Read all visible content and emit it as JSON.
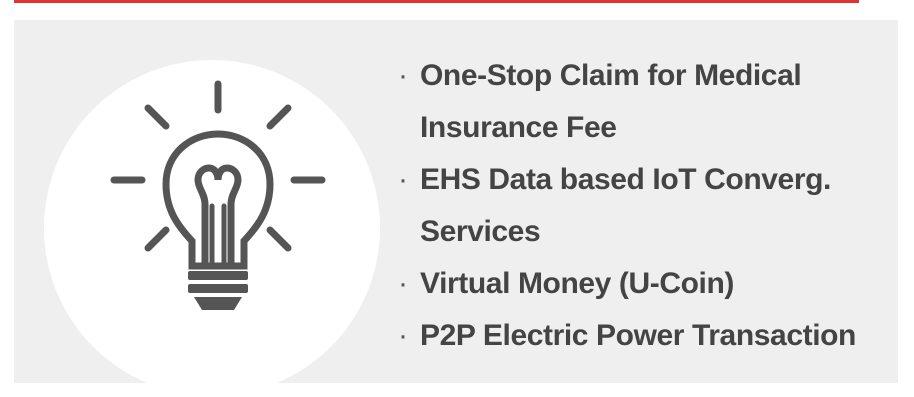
{
  "colors": {
    "accent_rule": "#e4322f",
    "panel_bg": "#efefef",
    "text": "#444444",
    "icon": "#555555"
  },
  "icon": "light-bulb-icon",
  "bullet_symbol": "·",
  "items": [
    "One-Stop Claim for Medical Insurance Fee",
    "EHS Data based IoT Converg. Services",
    "Virtual Money (U-Coin)",
    "P2P Electric Power Transaction"
  ]
}
